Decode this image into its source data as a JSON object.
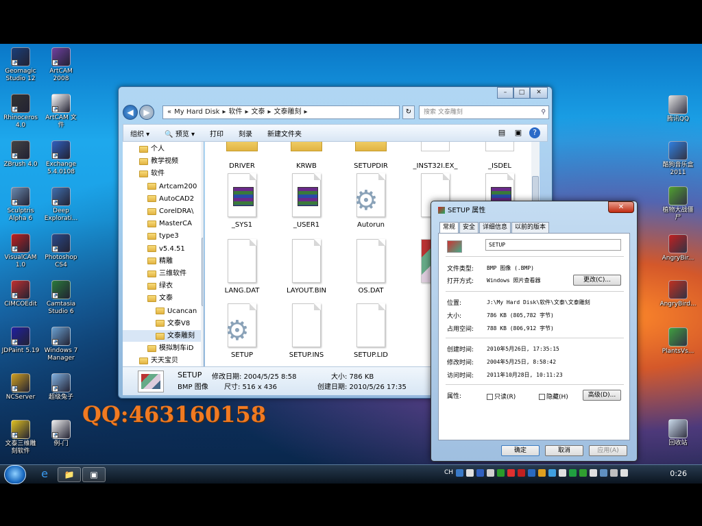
{
  "desktop": {
    "icons_left": [
      {
        "label": "Geomagic\nStudio 12",
        "color": "#1a3f7a",
        "name": "geomagic-icon"
      },
      {
        "label": "Rhinoceros\n4.0",
        "color": "#333333",
        "name": "rhinoceros-icon"
      },
      {
        "label": "ZBrush 4.0",
        "color": "#444444",
        "name": "zbrush-icon"
      },
      {
        "label": "Sculptris\nAlpha 6",
        "color": "#6a8ab0",
        "name": "sculptris-icon"
      },
      {
        "label": "VisualCAM\n1.0",
        "color": "#c02020",
        "name": "visualcam-icon"
      },
      {
        "label": "CIMCOEdit",
        "color": "#c03030",
        "name": "cimcoedit-icon"
      },
      {
        "label": "JDPaint 5.19",
        "color": "#2020a0",
        "name": "jdpaint-icon"
      },
      {
        "label": "NCServer",
        "color": "#d0a020",
        "name": "ncserver-icon"
      },
      {
        "label": "文泰三维雕\n刻软件",
        "color": "#e0c020",
        "name": "wentai3d-icon"
      }
    ],
    "icons_left2": [
      {
        "label": "ArtCAM\n2008",
        "color": "#7040a0",
        "name": "artcam-icon"
      },
      {
        "label": "ArtCAM 文\n件",
        "color": "#ffffff",
        "name": "artcam-file-icon"
      },
      {
        "label": "Exchange\n5.4.0108",
        "color": "#3060c0",
        "name": "exchange-icon"
      },
      {
        "label": "Deep\nExplorati...",
        "color": "#4070b0",
        "name": "deep-exploration-icon"
      },
      {
        "label": "Photoshop\nCS4",
        "color": "#2a4a8a",
        "name": "photoshop-icon"
      },
      {
        "label": "Camtasia\nStudio 6",
        "color": "#2a7a3a",
        "name": "camtasia-icon"
      },
      {
        "label": "Windows 7\nManager",
        "color": "#6aa0d0",
        "name": "windows7-manager-icon"
      },
      {
        "label": "超级兔子",
        "color": "#80b0e0",
        "name": "chaoji-tuzi-icon"
      },
      {
        "label": "例-门",
        "color": "#f0f0f0",
        "name": "li-men-icon"
      }
    ],
    "icons_right": [
      {
        "label": "腾讯QQ",
        "color": "#e0e0e0",
        "name": "tencent-qq-icon"
      },
      {
        "label": "酷狗音乐盒\n2011",
        "color": "#3080e0",
        "name": "kugou-icon"
      },
      {
        "label": "植物大战僵\n尸",
        "color": "#50a030",
        "name": "pvz-icon"
      },
      {
        "label": "AngryBir...",
        "color": "#c02020",
        "name": "angrybirds-icon"
      },
      {
        "label": "AngryBird...",
        "color": "#c03020",
        "name": "angrybirds2-icon"
      },
      {
        "label": "PlantsVs...",
        "color": "#40a040",
        "name": "plantsvs-icon"
      },
      {
        "label": "回收站",
        "color": "#c8d8e8",
        "name": "recycle-bin-icon"
      }
    ],
    "watermark": "QQ:463160158"
  },
  "explorer": {
    "caption_buttons": [
      "–",
      "□",
      "✕"
    ],
    "address_parts": [
      "«",
      "My Hard Disk",
      "▸",
      "软件",
      "▸",
      "文泰",
      "▸",
      "文泰雕刻",
      "▸"
    ],
    "search_placeholder": "搜索 文泰雕刻",
    "toolbar": [
      "组织 ▾",
      "🔍 预览 ▾",
      "打印",
      "刻录",
      "新建文件夹"
    ],
    "tree": [
      {
        "label": "个人",
        "indent": 1
      },
      {
        "label": "教学视频",
        "indent": 1
      },
      {
        "label": "软件",
        "indent": 1
      },
      {
        "label": "Artcam200",
        "indent": 2
      },
      {
        "label": "AutoCAD2",
        "indent": 2
      },
      {
        "label": "CorelDRA\\",
        "indent": 2
      },
      {
        "label": "MasterCA",
        "indent": 2
      },
      {
        "label": "type3",
        "indent": 2
      },
      {
        "label": "v5.4.51",
        "indent": 2
      },
      {
        "label": "精雕",
        "indent": 2
      },
      {
        "label": "三维软件",
        "indent": 2
      },
      {
        "label": "绿衣",
        "indent": 2
      },
      {
        "label": "文泰",
        "indent": 2
      },
      {
        "label": "Ucancan",
        "indent": 3
      },
      {
        "label": "文泰V8",
        "indent": 3
      },
      {
        "label": "文泰雕刻",
        "indent": 3
      },
      {
        "label": "模拟制车iD",
        "indent": 2
      },
      {
        "label": "天天宝贝",
        "indent": 1
      }
    ],
    "files_top": [
      "DRIVER",
      "KRWB",
      "SETUPDIR",
      "_INST32I.EX_",
      "_ISDEL"
    ],
    "files_row2": [
      {
        "label": "_SYS1",
        "kind": "rar"
      },
      {
        "label": "_USER1",
        "kind": "rar"
      },
      {
        "label": "Autorun",
        "kind": "gear"
      },
      {
        "label": "DA",
        "kind": "doc"
      },
      {
        "label": "",
        "kind": "rar"
      }
    ],
    "files_row3": [
      {
        "label": "LANG.DAT",
        "kind": "doc"
      },
      {
        "label": "LAYOUT.BIN",
        "kind": "doc"
      },
      {
        "label": "OS.DAT",
        "kind": "doc"
      },
      {
        "label": "S",
        "kind": "img"
      }
    ],
    "files_row4": [
      {
        "label": "SETUP",
        "kind": "gear"
      },
      {
        "label": "SETUP.INS",
        "kind": "doc"
      },
      {
        "label": "SETUP.LID",
        "kind": "doc"
      }
    ],
    "details": {
      "name": "SETUP",
      "type": "BMP 图像",
      "modified": "修改日期: 2004/5/25 8:58",
      "dims": "尺寸: 516 x 436",
      "size": "大小: 786 KB",
      "created": "创建日期: 2010/5/26 17:35"
    }
  },
  "props": {
    "title": "SETUP 属性",
    "close": "✕",
    "tabs": [
      "常规",
      "安全",
      "详细信息",
      "以前的版本"
    ],
    "filename": "SETUP",
    "rows": [
      {
        "k": "文件类型:",
        "v": "BMP 图像 (.BMP)"
      },
      {
        "k": "打开方式:",
        "v": "Windows 照片查看器"
      },
      {
        "k": "位置:",
        "v": "J:\\My Hard Disk\\软件\\文泰\\文泰雕刻"
      },
      {
        "k": "大小:",
        "v": "786 KB (805,782 字节)"
      },
      {
        "k": "占用空间:",
        "v": "788 KB (806,912 字节)"
      },
      {
        "k": "创建时间:",
        "v": "2010年5月26日, 17:35:15"
      },
      {
        "k": "修改时间:",
        "v": "2004年5月25日, 8:58:42"
      },
      {
        "k": "访问时间:",
        "v": "2011年10月28日, 10:11:23"
      },
      {
        "k": "属性:",
        "v": ""
      }
    ],
    "change_btn": "更改(C)...",
    "readonly": "只读(R)",
    "hidden": "隐藏(H)",
    "advanced": "高级(D)...",
    "ok": "确定",
    "cancel": "取消",
    "apply": "应用(A)"
  },
  "taskbar": {
    "lang": "CH",
    "clock": "0:26"
  },
  "colors": {
    "accent": "#1a78c8",
    "close": "#c02a10"
  }
}
